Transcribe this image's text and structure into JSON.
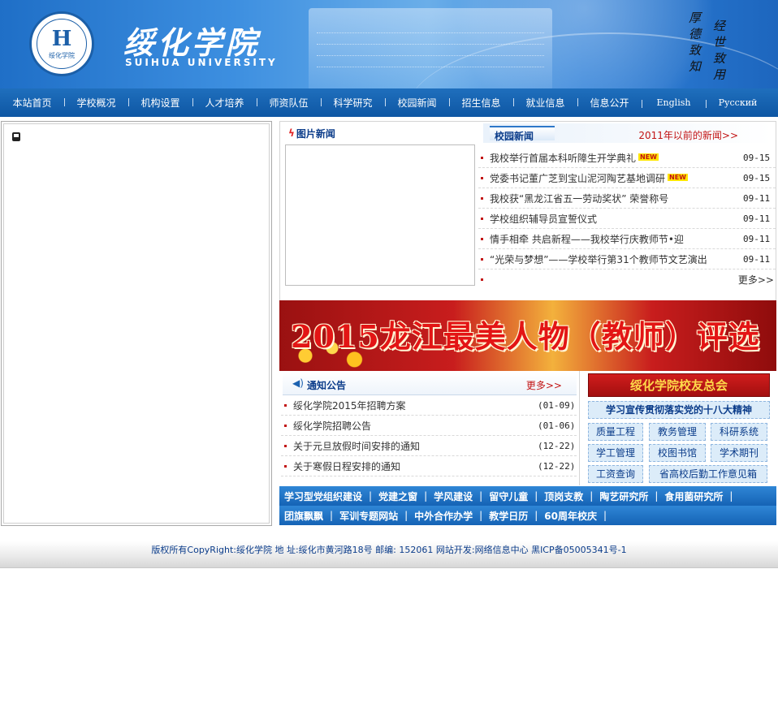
{
  "header": {
    "logo_mark": "H",
    "logo_sub": "绥化学院",
    "school_name_cn": "绥化学院",
    "school_name_en": "SUIHUA UNIVERSITY",
    "motto_col1": "厚德致知",
    "motto_col2": "经世致用"
  },
  "nav": {
    "items": [
      {
        "label": "本站首页"
      },
      {
        "label": "学校概况"
      },
      {
        "label": "机构设置"
      },
      {
        "label": "人才培养"
      },
      {
        "label": "师资队伍"
      },
      {
        "label": "科学研究"
      },
      {
        "label": "校园新闻"
      },
      {
        "label": "招生信息"
      },
      {
        "label": "就业信息"
      },
      {
        "label": "信息公开"
      },
      {
        "label": "English"
      },
      {
        "label": "Русский"
      }
    ]
  },
  "pic_news": {
    "title": "图片新闻"
  },
  "campus_news": {
    "tab_label": "校园新闻",
    "old_link": "2011年以前的新闻>>",
    "new_badge": "NEW",
    "items": [
      {
        "title": "我校举行首届本科听障生开学典礼",
        "date": "09-15",
        "is_new": true
      },
      {
        "title": "党委书记董广芝到宝山泥河陶艺基地调研",
        "date": "09-15",
        "is_new": true
      },
      {
        "title": "我校获“黑龙江省五一劳动奖状” 荣誉称号",
        "date": "09-11",
        "is_new": false
      },
      {
        "title": "学校组织辅导员宣誓仪式",
        "date": "09-11",
        "is_new": false
      },
      {
        "title": "情手相牵 共启新程——我校举行庆教师节•迎",
        "date": "09-11",
        "is_new": false
      },
      {
        "title": "“光荣与梦想”——学校举行第31个教师节文艺演出",
        "date": "09-11",
        "is_new": false
      }
    ],
    "more_label": "更多>>"
  },
  "banner": {
    "headline": "2015龙江最美人物（教师）评选"
  },
  "notices": {
    "title": "通知公告",
    "more_label": "更多>>",
    "items": [
      {
        "title": "绥化学院2015年招聘方案",
        "date": "(01-09)"
      },
      {
        "title": "绥化学院招聘公告",
        "date": "(01-06)"
      },
      {
        "title": "关于元旦放假时间安排的通知",
        "date": "(12-22)"
      },
      {
        "title": "关于寒假日程安排的通知",
        "date": "(12-22)"
      }
    ]
  },
  "side": {
    "alumni": "绥化学院校友总会",
    "spirit": "学习宣传贯彻落实党的十八大精神",
    "buttons": [
      {
        "label": "质量工程"
      },
      {
        "label": "教务管理"
      },
      {
        "label": "科研系统"
      },
      {
        "label": "学工管理"
      },
      {
        "label": "校图书馆"
      },
      {
        "label": "学术期刊"
      },
      {
        "label": "工资查询"
      },
      {
        "label": "省高校后勤工作意见箱"
      }
    ]
  },
  "links": {
    "row1": [
      {
        "label": "学习型党组织建设"
      },
      {
        "label": "党建之窗"
      },
      {
        "label": "学风建设"
      },
      {
        "label": "留守儿童"
      },
      {
        "label": "顶岗支教"
      },
      {
        "label": "陶艺研究所"
      },
      {
        "label": "食用菌研究所"
      }
    ],
    "row2": [
      {
        "label": "团旗飘飘"
      },
      {
        "label": "军训专题网站"
      },
      {
        "label": "中外合作办学"
      },
      {
        "label": "教学日历"
      },
      {
        "label": "60周年校庆"
      }
    ],
    "separator": "|"
  },
  "footer": {
    "text": "版权所有CopyRight:绥化学院 地 址:绥化市黄河路18号 邮编: 152061 网站开发:网络信息中心 黑ICP备05005341号-1"
  },
  "colors": {
    "nav_bg": "#0e56a3",
    "title_blue": "#0b3c8a",
    "accent_red": "#c21414",
    "banner_red": "#c81d1d"
  }
}
